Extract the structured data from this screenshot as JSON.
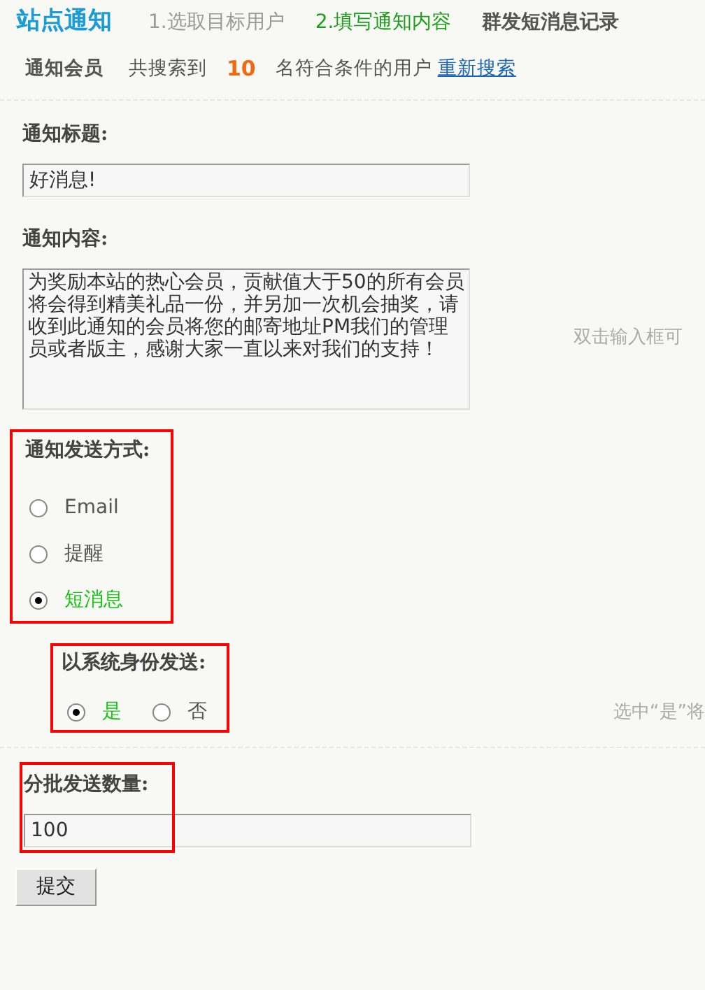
{
  "header": {
    "title": "站点通知",
    "steps": [
      {
        "label": "1.选取目标用户",
        "selected": false
      },
      {
        "label": "2.填写通知内容",
        "selected": true
      }
    ],
    "link": "群发短消息记录"
  },
  "members": {
    "label": "通知会员",
    "prefix": "共搜索到",
    "count": "10",
    "suffix": "名符合条件的用户",
    "link": "重新搜索"
  },
  "title_field": {
    "label": "通知标题:",
    "value": "好消息!"
  },
  "content_field": {
    "label": "通知内容:",
    "value": "为奖励本站的热心会员，贡献值大于50的所有会员将会得到精美礼品一份，并另加一次机会抽奖，请收到此通知的会员将您的邮寄地址PM我们的管理员或者版主，感谢大家一直以来对我们的支持！",
    "hint": "双击输入框可"
  },
  "send_method": {
    "label": "通知发送方式:",
    "highlighted": true,
    "options": [
      {
        "label": "Email",
        "selected": false
      },
      {
        "label": "提醒",
        "selected": false
      },
      {
        "label": "短消息",
        "selected": true
      }
    ]
  },
  "system_send": {
    "label": "以系统身份发送:",
    "highlighted": true,
    "options": [
      {
        "label": "是",
        "selected": true
      },
      {
        "label": "否",
        "selected": false
      }
    ],
    "hint": "选中“是”将"
  },
  "batch": {
    "label": "分批发送数量:",
    "highlighted": true,
    "value": "100"
  },
  "submit": "提交"
}
